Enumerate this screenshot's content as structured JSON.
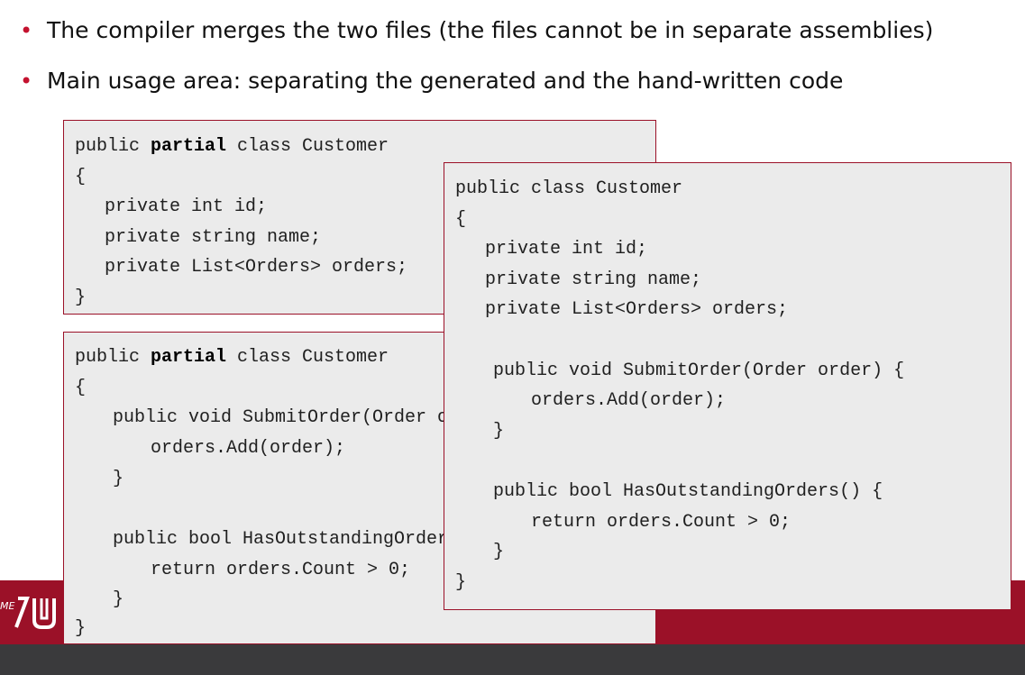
{
  "bullets": [
    "The compiler merges the two files (the files cannot be in separate assemblies)",
    "Main usage area: separating the generated and the hand-written code"
  ],
  "code_partial_fields": {
    "decl_pre": "public ",
    "decl_kw": "partial",
    "decl_post": " class Customer",
    "open": "{",
    "l1": "private int id;",
    "l2": "private string name;",
    "l3": "private List<Orders> orders;",
    "close": "}"
  },
  "code_partial_methods": {
    "decl_pre": "public ",
    "decl_kw": "partial",
    "decl_post": " class Customer",
    "open": "{",
    "m1": "public void SubmitOrder(Order order) {",
    "m1b": "orders.Add(order);",
    "m1c": "}",
    "m2": "public bool HasOutstandingOrders() {",
    "m2b": "return orders.Count > 0;",
    "m2c": "}",
    "close": "}"
  },
  "code_merged": {
    "decl": "public class Customer",
    "open": "{",
    "l1": "private int id;",
    "l2": "private string name;",
    "l3": "private List<Orders> orders;",
    "m1": "public void SubmitOrder(Order order) {",
    "m1b": "orders.Add(order);",
    "m1c": "}",
    "m2": "public bool HasOutstandingOrders() {",
    "m2b": "return orders.Count > 0;",
    "m2c": "}",
    "close": "}"
  },
  "logo": {
    "text": "ME",
    "icon": "university-logo-icon"
  },
  "colors": {
    "accent": "#9b1128",
    "footer_dark": "#3a3a3c",
    "code_bg": "#ebebeb"
  }
}
